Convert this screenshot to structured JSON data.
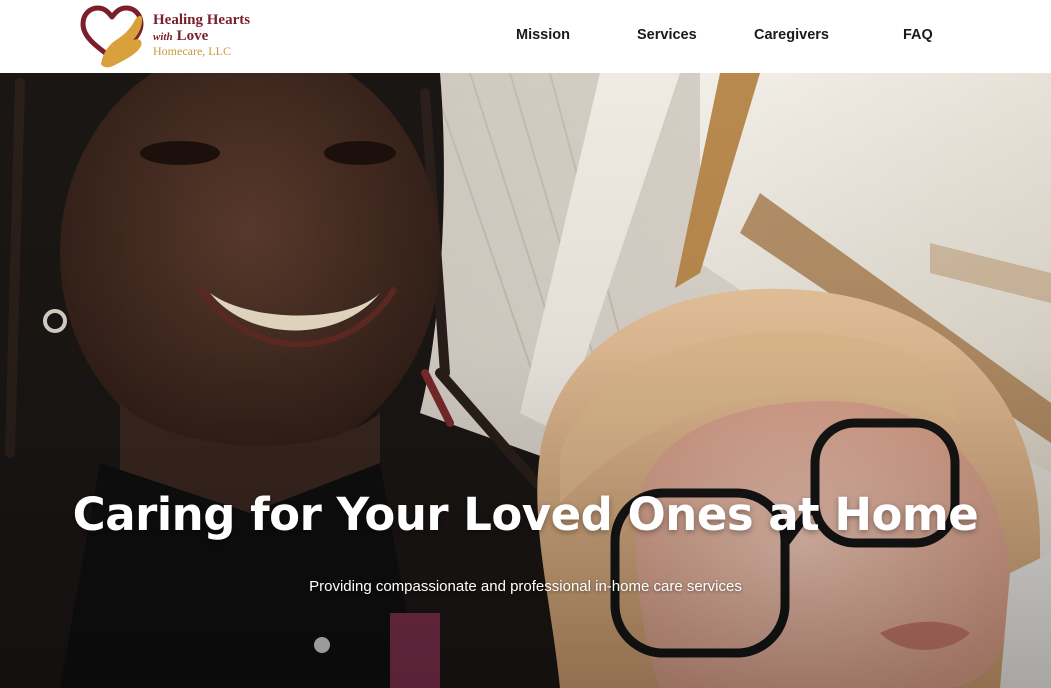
{
  "brand": {
    "line1": "Healing Hearts",
    "line2_prefix": "with",
    "line2_main": "Love",
    "line3": "Homecare, LLC",
    "heart_color": "#7a1f2b",
    "hand_color": "#d9a13b"
  },
  "nav": {
    "items": [
      "Mission",
      "Services",
      "Caregivers",
      "FAQ"
    ]
  },
  "hero": {
    "title": "Caring for Your Loved Ones at Home",
    "subtitle": "Providing compassionate and professional in-home care services",
    "image_icon": "caregiver-photo"
  }
}
